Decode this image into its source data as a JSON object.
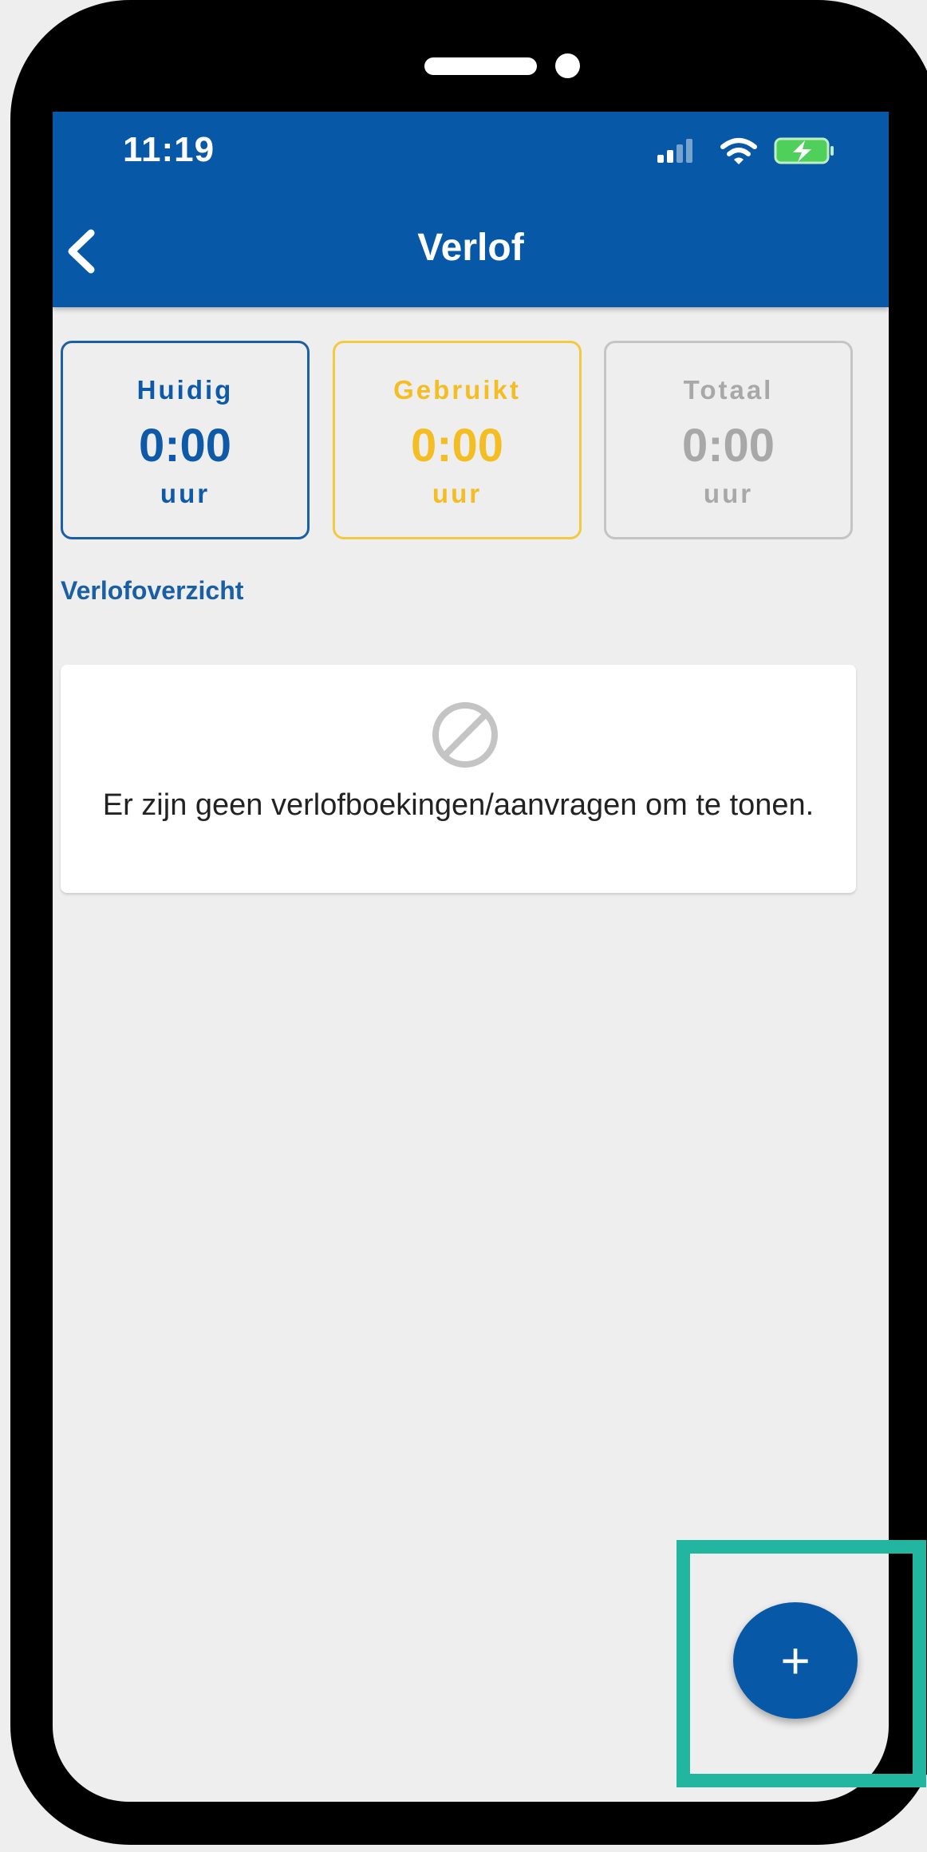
{
  "status_bar": {
    "time": "11:19",
    "signal_icon": "cellular-signal-icon",
    "wifi_icon": "wifi-icon",
    "battery_icon": "battery-charging-icon"
  },
  "header": {
    "title": "Verlof",
    "back_icon": "chevron-left-icon",
    "background_color": "#0759a8"
  },
  "summary_cards": [
    {
      "label": "Huidig",
      "value": "0:00",
      "unit": "uur",
      "color": "#0f5aa8"
    },
    {
      "label": "Gebruikt",
      "value": "0:00",
      "unit": "uur",
      "color": "#f4bd23"
    },
    {
      "label": "Totaal",
      "value": "0:00",
      "unit": "uur",
      "color": "#a8a8a8"
    }
  ],
  "overview": {
    "title": "Verlofoverzicht",
    "empty_icon": "prohibited-icon",
    "empty_message": "Er zijn geen verlofboekingen/aanvragen om te tonen."
  },
  "fab": {
    "label": "+",
    "icon": "plus-icon",
    "highlight_color": "#22b5a0"
  }
}
